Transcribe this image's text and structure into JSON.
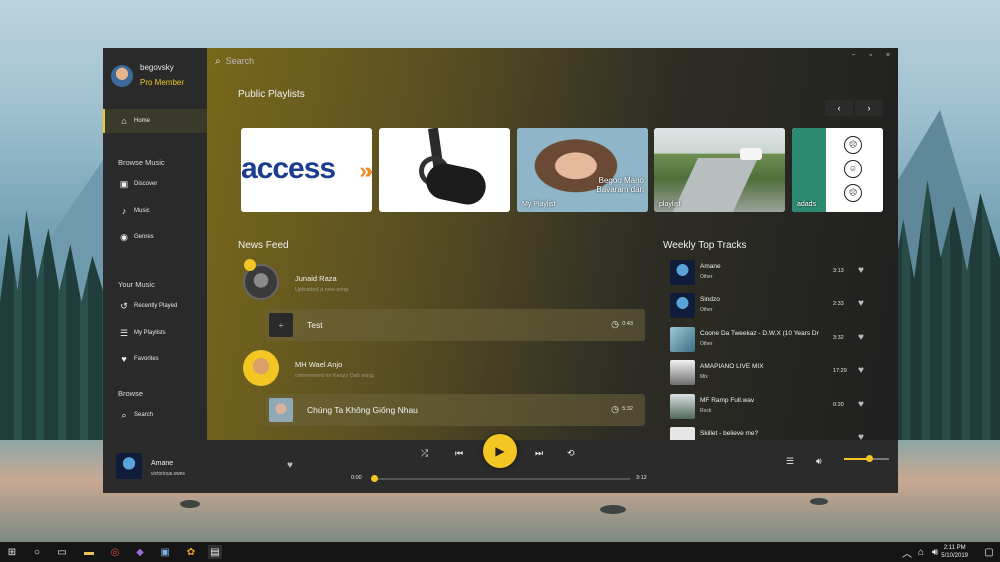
{
  "user": {
    "name": "begovsky",
    "membership": "Pro Member"
  },
  "nav": {
    "home": "Home",
    "browse_music_heading": "Browse Music",
    "discover": "Discover",
    "music": "Music",
    "genres": "Genres",
    "your_music_heading": "Your Music",
    "recently_played": "Recently Played",
    "my_playlists": "My Playlists",
    "favorites": "Favorites",
    "browse_heading": "Browse",
    "search": "Search"
  },
  "search": {
    "placeholder": "Search"
  },
  "window_controls": {
    "minimize": "−",
    "maximize": "▫",
    "close": "×"
  },
  "public_playlists": {
    "title": "Public Playlists",
    "cards": [
      {
        "label": "",
        "logo_text": "access",
        "logo_arrows": "»»"
      },
      {
        "label": ""
      },
      {
        "label": "My Playlist",
        "overlay_text_1": "Begoo Mano",
        "overlay_text_2": "Bavaram dari"
      },
      {
        "label": "playlist"
      },
      {
        "label": "adads"
      }
    ]
  },
  "news_feed": {
    "title": "News Feed",
    "items": [
      {
        "name": "Junaid Raza",
        "activity": "Uploaded a new song.",
        "song": "Test",
        "duration": "0:43"
      },
      {
        "name": "MH Wael Anjo",
        "activity": "commented on Kenzy Dah song.",
        "song": "Chúng Ta Không Giống Nhau",
        "duration": "5:32"
      }
    ]
  },
  "weekly_top": {
    "title": "Weekly Top Tracks",
    "tracks": [
      {
        "name": "Amane",
        "genre": "Other",
        "duration": "3:13"
      },
      {
        "name": "Sindzo",
        "genre": "Other",
        "duration": "2:33"
      },
      {
        "name": "Coone  Da Tweekaz - D.W.X (10 Years Dr",
        "genre": "Other",
        "duration": "3:32"
      },
      {
        "name": "AMAPIANO LIVE MIX",
        "genre": "Mix",
        "duration": "17:29"
      },
      {
        "name": "MF Ramp Full.wav",
        "genre": "Rock",
        "duration": "0:20"
      },
      {
        "name": "Skillet - believe me?",
        "genre": "",
        "duration": ""
      }
    ]
  },
  "player": {
    "now_playing_title": "Amane",
    "now_playing_artist": "victorious.swes",
    "current_time": "0:00",
    "total_time": "3:12",
    "progress": 0,
    "volume": 0.55
  },
  "taskbar": {
    "time": "2:11 PM",
    "date": "5/10/2019"
  },
  "colors": {
    "accent": "#f3c623",
    "sidebar": "#2a2a2a",
    "player": "#2b2b2b"
  }
}
